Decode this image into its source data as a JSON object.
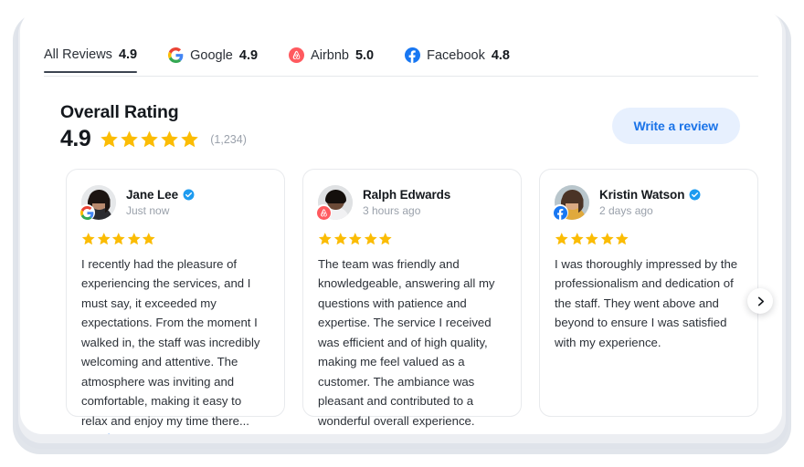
{
  "tabs": [
    {
      "label": "All Reviews",
      "score": "4.9",
      "icon": "none",
      "active": true
    },
    {
      "label": "Google",
      "score": "4.9",
      "icon": "google-icon",
      "active": false
    },
    {
      "label": "Airbnb",
      "score": "5.0",
      "icon": "airbnb-icon",
      "active": false
    },
    {
      "label": "Facebook",
      "score": "4.8",
      "icon": "facebook-icon",
      "active": false
    }
  ],
  "overall": {
    "title": "Overall Rating",
    "score": "4.9",
    "stars": 5,
    "count": "(1,234)"
  },
  "write_review_button": "Write a review",
  "carousel": {
    "next_icon": "chevron-right-icon"
  },
  "reviews": [
    {
      "name": "Jane Lee",
      "verified": true,
      "time": "Just now",
      "source": "google-icon",
      "stars": 5,
      "text": "I recently had the pleasure of experiencing the services, and I must say, it exceeded my expectations. From the moment I walked in, the staff was incredibly welcoming and attentive. The atmosphere was inviting and comfortable, making it easy to relax and enjoy my time there...",
      "read_more": "Read more"
    },
    {
      "name": "Ralph Edwards",
      "verified": false,
      "time": "3 hours ago",
      "source": "airbnb-icon",
      "stars": 5,
      "text": "The team was friendly and knowledgeable, answering all my questions with patience and expertise. The service I received was efficient and of high quality, making me feel valued as a customer. The ambiance was pleasant and contributed to a wonderful overall experience.",
      "read_more": ""
    },
    {
      "name": "Kristin Watson",
      "verified": true,
      "time": "2 days ago",
      "source": "facebook-icon",
      "stars": 5,
      "text": "I was thoroughly impressed by the professionalism and dedication of the staff. They went above and beyond to ensure I was satisfied with my experience.",
      "read_more": ""
    }
  ],
  "colors": {
    "star": "#FBBC04",
    "accent_blue": "#1a73e8",
    "link_blue": "#4a90f0",
    "verified_blue": "#1d9bf0",
    "airbnb": "#FF5A5F",
    "facebook": "#1877F2",
    "button_bg": "#e7f0fe"
  }
}
